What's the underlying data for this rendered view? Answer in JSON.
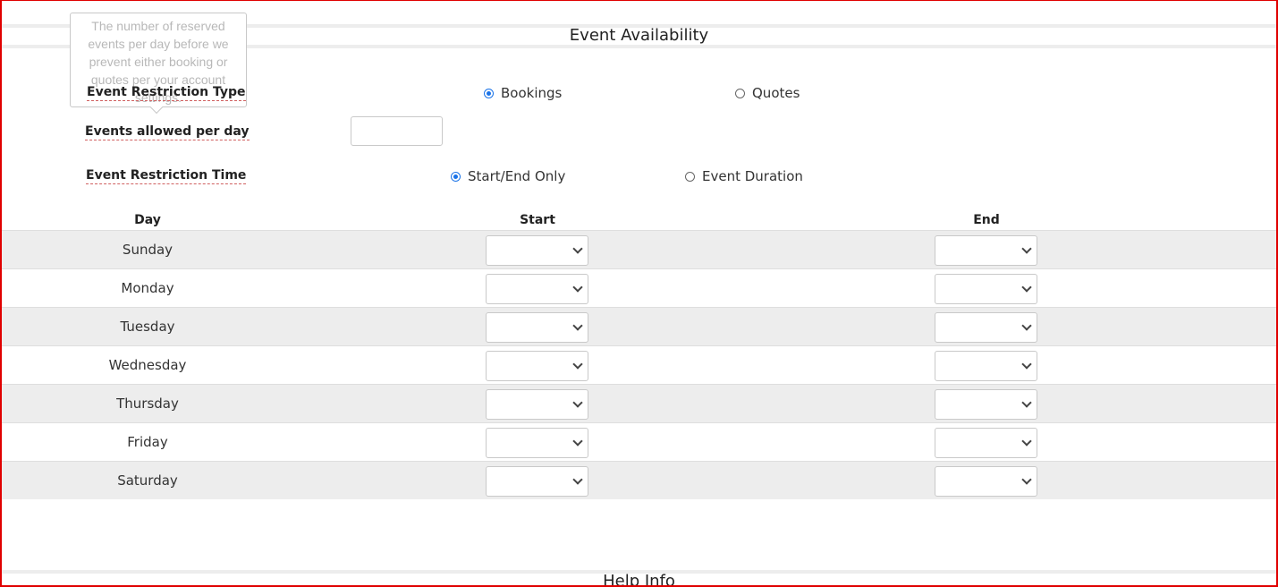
{
  "section": {
    "title": "Event Availability",
    "help_title": "Help Info"
  },
  "tooltip": {
    "text": "The number of reserved events per day before we prevent either booking or quotes per your account settings."
  },
  "restriction_type": {
    "label": "Event Restriction Type",
    "options": [
      {
        "label": "Bookings",
        "checked": true
      },
      {
        "label": "Quotes",
        "checked": false
      }
    ]
  },
  "events_per_day": {
    "label": "Events allowed per day",
    "value": ""
  },
  "restriction_time": {
    "label": "Event Restriction Time",
    "options": [
      {
        "label": "Start/End Only",
        "checked": true
      },
      {
        "label": "Event Duration",
        "checked": false
      }
    ]
  },
  "table": {
    "headers": {
      "day": "Day",
      "start": "Start",
      "end": "End"
    },
    "rows": [
      {
        "day": "Sunday",
        "start": "",
        "end": ""
      },
      {
        "day": "Monday",
        "start": "",
        "end": ""
      },
      {
        "day": "Tuesday",
        "start": "",
        "end": ""
      },
      {
        "day": "Wednesday",
        "start": "",
        "end": ""
      },
      {
        "day": "Thursday",
        "start": "",
        "end": ""
      },
      {
        "day": "Friday",
        "start": "",
        "end": ""
      },
      {
        "day": "Saturday",
        "start": "",
        "end": ""
      }
    ]
  },
  "colors": {
    "accent": "#1a73e8",
    "frame": "#e00000",
    "row_shade": "#ededed"
  }
}
